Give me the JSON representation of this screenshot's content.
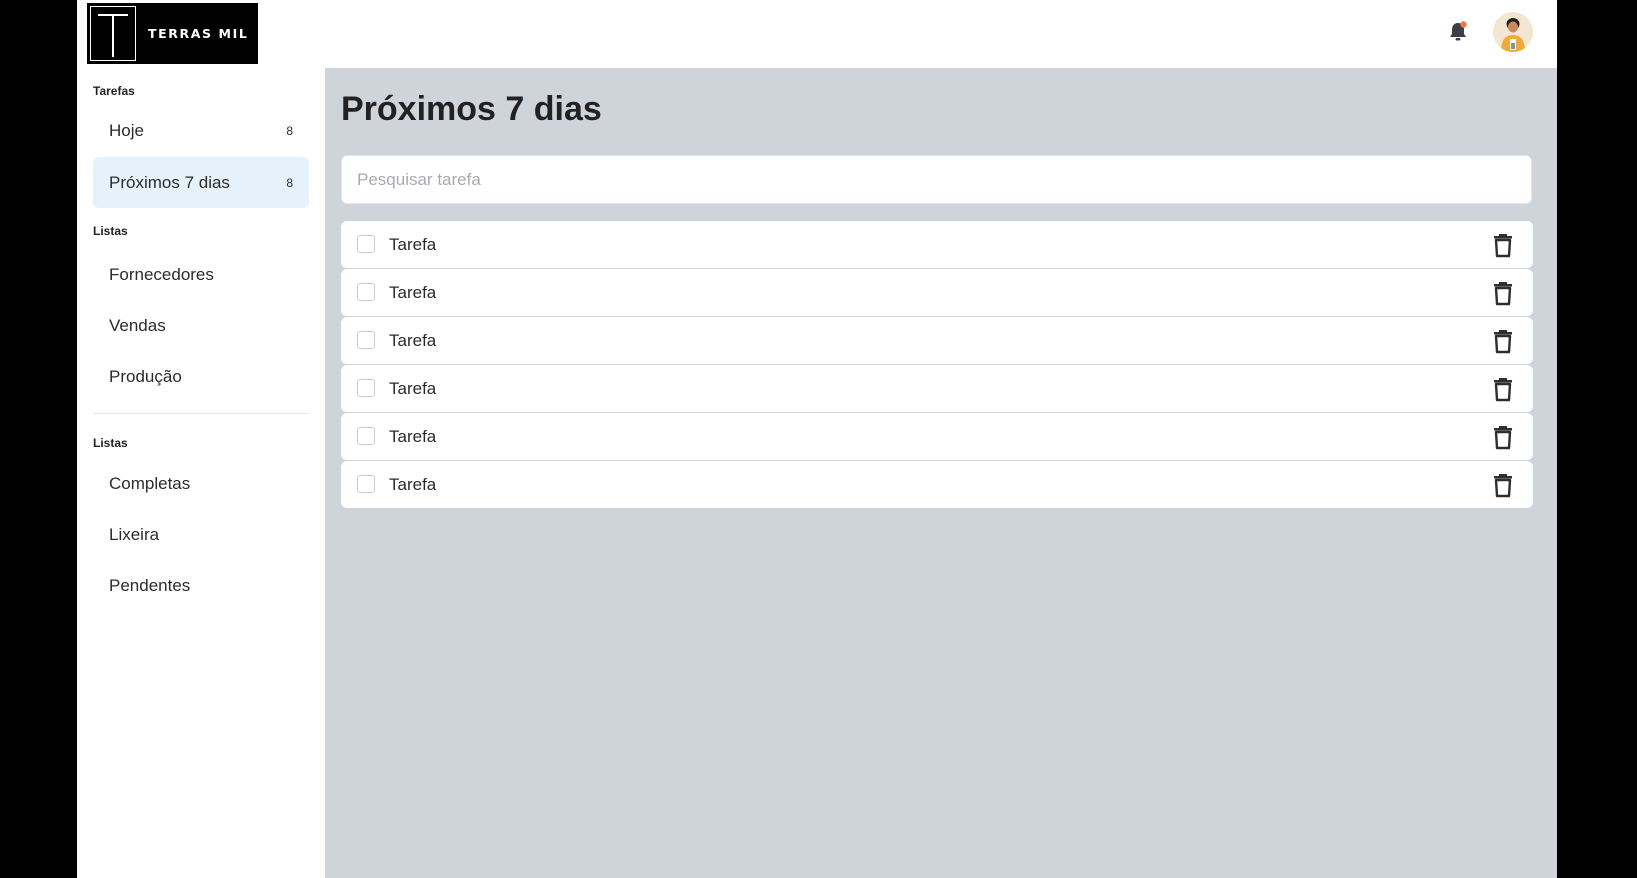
{
  "header": {
    "logo_letter": "T",
    "logo_text": "TERRAS MIL",
    "notification_dot_color": "#f07a3a",
    "icons": [
      "bell-icon",
      "avatar"
    ]
  },
  "sidebar": {
    "section_tasks": "Tarefas",
    "tasks_items": [
      {
        "label": "Hoje",
        "count": "8",
        "active": false
      },
      {
        "label": "Próximos 7 dias",
        "count": "8",
        "active": true
      }
    ],
    "section_lists": "Listas",
    "lists_items": [
      {
        "label": "Fornecedores"
      },
      {
        "label": "Vendas"
      },
      {
        "label": "Produção"
      }
    ],
    "section_lists_2": "Listas",
    "status_items": [
      {
        "label": "Completas"
      },
      {
        "label": "Lixeira"
      },
      {
        "label": "Pendentes"
      }
    ],
    "active_color": "#e6f2fb"
  },
  "main": {
    "title": "Próximos 7 dias",
    "search_placeholder": "Pesquisar tarefa",
    "search_value": "",
    "tasks": [
      {
        "label": "Tarefa",
        "checked": false
      },
      {
        "label": "Tarefa",
        "checked": false
      },
      {
        "label": "Tarefa",
        "checked": false
      },
      {
        "label": "Tarefa",
        "checked": false
      },
      {
        "label": "Tarefa",
        "checked": false
      },
      {
        "label": "Tarefa",
        "checked": false
      }
    ],
    "background_color": "#cfd4db"
  }
}
